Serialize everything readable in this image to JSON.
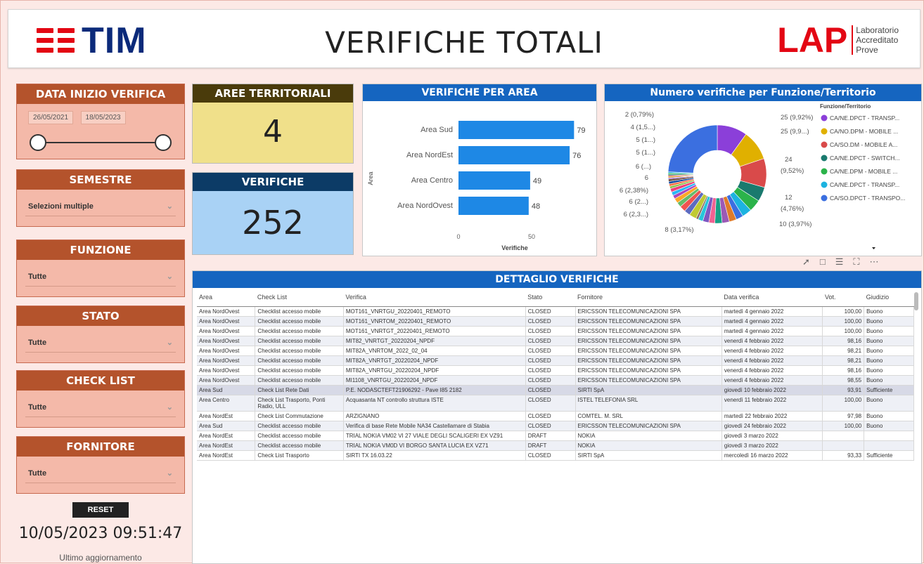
{
  "header": {
    "title": "VERIFICHE TOTALI",
    "tim_logo": "TIM",
    "lap_logo": "LAP",
    "lap_sub": [
      "Laboratorio",
      "Accreditato",
      "Prove"
    ]
  },
  "filters": {
    "data_inizio": {
      "label": "DATA INIZIO VERIFICA",
      "start": "26/05/2021",
      "end": "18/05/2023"
    },
    "semestre": {
      "label": "SEMESTRE",
      "value": "Selezioni multiple"
    },
    "funzione": {
      "label": "FUNZIONE",
      "value": "Tutte"
    },
    "stato": {
      "label": "STATO",
      "value": "Tutte"
    },
    "check_list": {
      "label": "CHECK LIST",
      "value": "Tutte"
    },
    "fornitore": {
      "label": "FORNITORE",
      "value": "Tutte"
    }
  },
  "reset_label": "RESET",
  "last_update": {
    "value": "10/05/2023 09:51:47",
    "label": "Ultimo aggiornamento"
  },
  "kpis": {
    "aree": {
      "label": "AREE TERRITORIALI",
      "value": "4"
    },
    "verifiche": {
      "label": "VERIFICHE",
      "value": "252"
    }
  },
  "bar_card": {
    "title": "VERIFICHE PER AREA"
  },
  "donut_card": {
    "title": "Numero verifiche per Funzione/Territorio",
    "legend_title": "Funzione/Territorio"
  },
  "table": {
    "title": "DETTAGLIO VERIFICHE",
    "columns": [
      "Area",
      "Check List",
      "Verifica",
      "Stato",
      "Fornitore",
      "Data verifica",
      "Vot.",
      "Giudizio"
    ]
  },
  "chart_data": [
    {
      "type": "bar",
      "orientation": "horizontal",
      "title": "VERIFICHE PER AREA",
      "categories": [
        "Area Sud",
        "Area NordEst",
        "Area Centro",
        "Area NordOvest"
      ],
      "values": [
        79,
        76,
        49,
        48
      ],
      "xlabel": "Verifiche",
      "ylabel": "Area",
      "xticks": [
        "0",
        "50"
      ],
      "xlim": [
        0,
        80
      ]
    },
    {
      "type": "pie",
      "title": "Numero verifiche per Funzione/Territorio",
      "legend": [
        "CA/NE.DPCT - TRANSP...",
        "CA/NO.DPM - MOBILE ...",
        "CA/SO.DM - MOBILE A...",
        "CA/NE.DPCT - SWITCH...",
        "CA/NE.DPM - MOBILE ...",
        "CA/NE.DPCT - TRANSP...",
        "CA/SO.DPCT - TRANSPO..."
      ],
      "legend_colors": [
        "#8b3fd9",
        "#e0b000",
        "#d94a4a",
        "#1a7a6e",
        "#2bb34a",
        "#1cb3e0",
        "#3b6fe0"
      ],
      "values": [
        25,
        25,
        24,
        12,
        10,
        8,
        6,
        6,
        6,
        6,
        5,
        5,
        4,
        2
      ],
      "labels": [
        "25 (9,92%)",
        "25 (9,9...)",
        "24 (9,52%)",
        "12 (4,76%)",
        "10 (3,97%)",
        "8 (3,17%)",
        "6 (2,3...)",
        "6 (2...)",
        "6 (2,38%)",
        "6 (...)",
        "5 (1...)",
        "5 (1...)",
        "4 (1,5...)",
        "2 (0,79%)"
      ],
      "slice_colors": [
        "#8b3fd9",
        "#e0b000",
        "#d94a4a",
        "#1a7a6e",
        "#2bb34a",
        "#1cb3e0",
        "#3b6fe0",
        "#e07b2a",
        "#9b59b6",
        "#16a085",
        "#f06292",
        "#7e57c2",
        "#26c6da",
        "#8d6e63",
        "#c0ca33",
        "#5c6bc0",
        "#ef5350",
        "#66bb6a",
        "#ffa726",
        "#ab47bc",
        "#29b6f6",
        "#ec407a",
        "#8bc34a",
        "#ff7043",
        "#0d47a1",
        "#6d4c41"
      ]
    }
  ],
  "rows": [
    {
      "area": "Area NordOvest",
      "check": "Checklist accesso mobile",
      "verifica": "MOT161_VNRTGU_20220401_REMOTO",
      "stato": "CLOSED",
      "fornitore": "ERICSSON TELECOMUNICAZIONI SPA",
      "data": "martedì 4 gennaio 2022",
      "vot": "100,00",
      "giudizio": "Buono"
    },
    {
      "area": "Area NordOvest",
      "check": "Checklist accesso mobile",
      "verifica": "MOT161_VNRTOM_20220401_REMOTO",
      "stato": "CLOSED",
      "fornitore": "ERICSSON TELECOMUNICAZIONI SPA",
      "data": "martedì 4 gennaio 2022",
      "vot": "100,00",
      "giudizio": "Buono"
    },
    {
      "area": "Area NordOvest",
      "check": "Checklist accesso mobile",
      "verifica": "MOT161_VNRTGT_20220401_REMOTO",
      "stato": "CLOSED",
      "fornitore": "ERICSSON TELECOMUNICAZIONI SPA",
      "data": "martedì 4 gennaio 2022",
      "vot": "100,00",
      "giudizio": "Buono"
    },
    {
      "area": "Area NordOvest",
      "check": "Checklist accesso mobile",
      "verifica": "MIT82_VNRTGT_20220204_NPDF",
      "stato": "CLOSED",
      "fornitore": "ERICSSON TELECOMUNICAZIONI SPA",
      "data": "venerdì 4 febbraio 2022",
      "vot": "98,16",
      "giudizio": "Buono"
    },
    {
      "area": "Area NordOvest",
      "check": "Checklist accesso mobile",
      "verifica": "MIT82A_VNRTOM_2022_02_04",
      "stato": "CLOSED",
      "fornitore": "ERICSSON TELECOMUNICAZIONI SPA",
      "data": "venerdì 4 febbraio 2022",
      "vot": "98,21",
      "giudizio": "Buono"
    },
    {
      "area": "Area NordOvest",
      "check": "Checklist accesso mobile",
      "verifica": "MIT82A_VNRTGT_20220204_NPDF",
      "stato": "CLOSED",
      "fornitore": "ERICSSON TELECOMUNICAZIONI SPA",
      "data": "venerdì 4 febbraio 2022",
      "vot": "98,21",
      "giudizio": "Buono"
    },
    {
      "area": "Area NordOvest",
      "check": "Checklist accesso mobile",
      "verifica": "MIT82A_VNRTGU_20220204_NPDF",
      "stato": "CLOSED",
      "fornitore": "ERICSSON TELECOMUNICAZIONI SPA",
      "data": "venerdì 4 febbraio 2022",
      "vot": "98,16",
      "giudizio": "Buono"
    },
    {
      "area": "Area NordOvest",
      "check": "Checklist accesso mobile",
      "verifica": "MI1108_VNRTGU_20220204_NPDF",
      "stato": "CLOSED",
      "fornitore": "ERICSSON TELECOMUNICAZIONI SPA",
      "data": "venerdì 4 febbraio 2022",
      "vot": "98,55",
      "giudizio": "Buono"
    },
    {
      "area": "Area Sud",
      "check": "Check List Rete Dati",
      "verifica": "P.E. NODASCTEFT21906292 - Pave I85 2182",
      "stato": "CLOSED",
      "fornitore": "SIRTI SpA",
      "data": "giovedì 10 febbraio 2022",
      "vot": "93,91",
      "giudizio": "Sufficiente"
    },
    {
      "area": "Area Centro",
      "check": "Check List Trasporto, Ponti Radio, ULL",
      "verifica": "Acquasanta NT controllo struttura ISTE",
      "stato": "CLOSED",
      "fornitore": "ISTEL TELEFONIA SRL",
      "data": "venerdì 11 febbraio 2022",
      "vot": "100,00",
      "giudizio": "Buono"
    },
    {
      "area": "Area NordEst",
      "check": "Check List Commutazione",
      "verifica": "ARZIGNANO",
      "stato": "CLOSED",
      "fornitore": "COMTEL. M. SRL",
      "data": "martedì 22 febbraio 2022",
      "vot": "97,98",
      "giudizio": "Buono"
    },
    {
      "area": "Area Sud",
      "check": "Checklist accesso mobile",
      "verifica": "Verifica di base Rete Mobile NA34 Castellamare di Stabia",
      "stato": "CLOSED",
      "fornitore": "ERICSSON TELECOMUNICAZIONI SPA",
      "data": "giovedì 24 febbraio 2022",
      "vot": "100,00",
      "giudizio": "Buono"
    },
    {
      "area": "Area NordEst",
      "check": "Checklist accesso mobile",
      "verifica": "TRIAL NOKIA VM02 VI 27 VIALE DEGLI SCALIGERI EX VZ91",
      "stato": "DRAFT",
      "fornitore": "NOKIA",
      "data": "giovedì 3 marzo 2022",
      "vot": "",
      "giudizio": ""
    },
    {
      "area": "Area NordEst",
      "check": "Checklist accesso mobile",
      "verifica": "TRIAL NOKIA VM0D VI BORGO SANTA LUCIA EX VZ71",
      "stato": "DRAFT",
      "fornitore": "NOKIA",
      "data": "giovedì 3 marzo 2022",
      "vot": "",
      "giudizio": ""
    },
    {
      "area": "Area NordEst",
      "check": "Check List Trasporto",
      "verifica": "SIRTI TX 16.03.22",
      "stato": "CLOSED",
      "fornitore": "SIRTI SpA",
      "data": "mercoledì 16 marzo 2022",
      "vot": "93,33",
      "giudizio": "Sufficiente"
    }
  ]
}
